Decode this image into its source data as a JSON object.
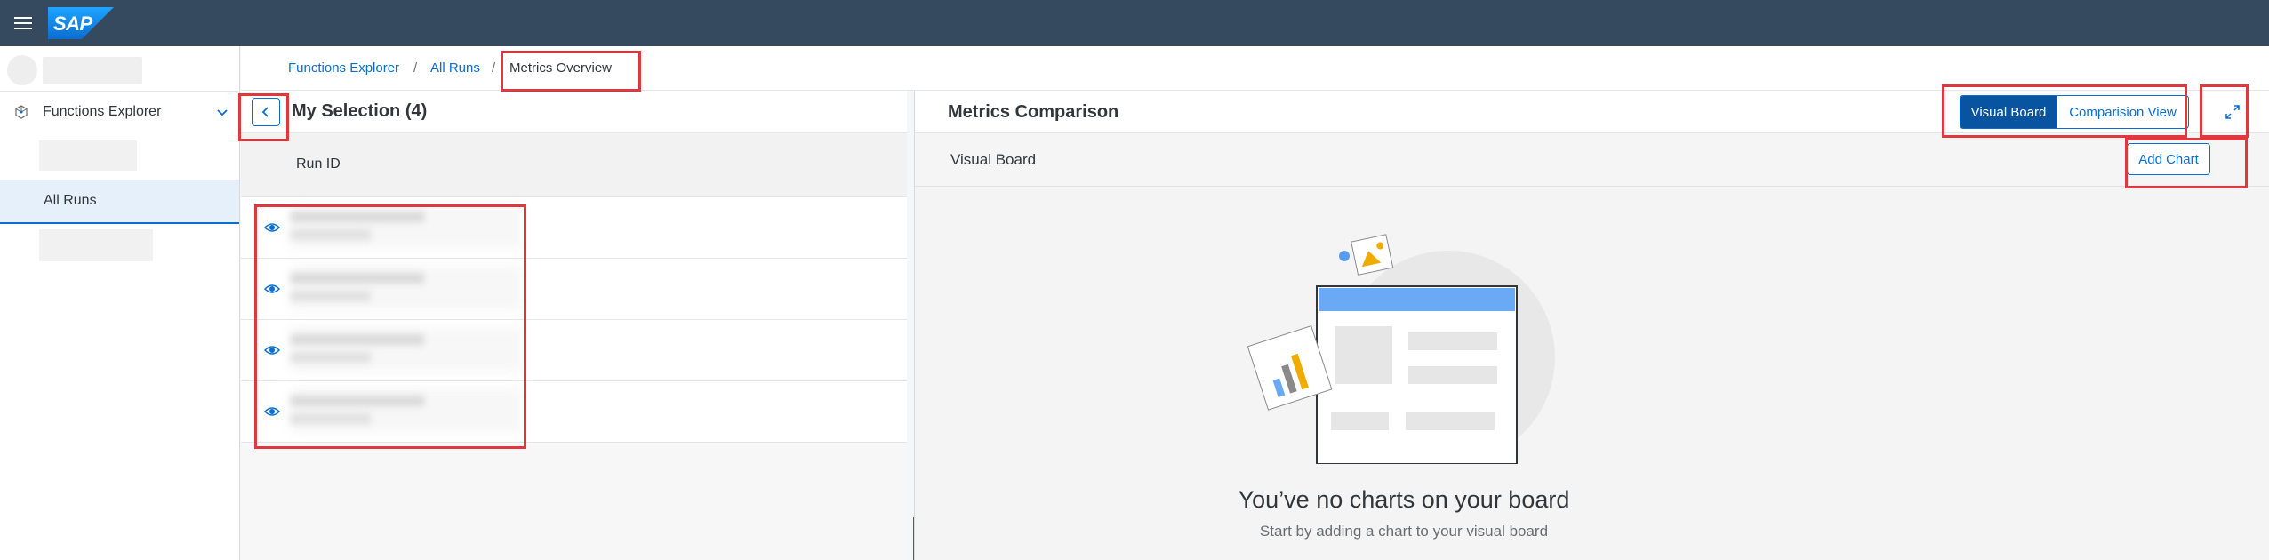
{
  "shell": {
    "logo_text": "SAP",
    "menu_icon": "hamburger-menu-icon"
  },
  "sidebar": {
    "group_label": "Functions Explorer",
    "group_icon": "functions-explorer-icon",
    "active_item_label": "All Runs"
  },
  "breadcrumb": {
    "items": [
      "Functions Explorer",
      "All Runs",
      "Metrics Overview"
    ],
    "separator": "/"
  },
  "selection": {
    "title": "My Selection (4)",
    "column_header": "Run ID",
    "row_icon": "eye-icon",
    "back_icon": "chevron-left-icon"
  },
  "metrics": {
    "title": "Metrics Comparison",
    "segments": [
      "Visual Board",
      "Comparision View"
    ],
    "selected_segment": "Visual Board",
    "expand_icon": "fullscreen-icon",
    "board_label": "Visual Board",
    "add_chart_label": "Add Chart",
    "empty_title": "You’ve no charts on your board",
    "empty_subtitle": "Start by adding a chart to your visual board"
  },
  "colors": {
    "shell": "#354a5f",
    "accent": "#0a6ed1",
    "selected_segment": "#0854a0",
    "highlight": "#e0383f"
  }
}
